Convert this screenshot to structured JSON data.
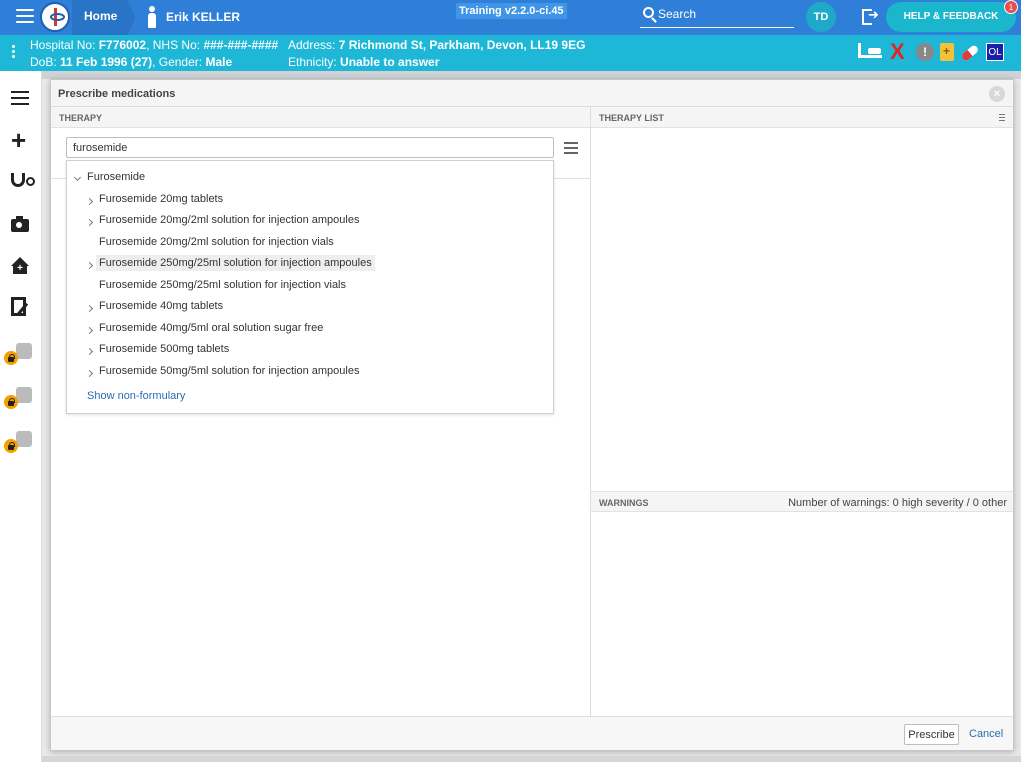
{
  "topbar": {
    "home_label": "Home",
    "patient_name": "Erik KELLER",
    "environment": "Training v2.2.0-ci.45",
    "search_label": "Search",
    "user_initials": "TD",
    "help_label": "HELP & FEEDBACK",
    "help_badge": "1",
    "accent": "#2f7fd8"
  },
  "banner": {
    "hospital_label": "Hospital No: ",
    "hospital_no": "F776002",
    "nhs_label": ", NHS No: ",
    "nhs_no": "###-###-####",
    "dob_label": "DoB: ",
    "dob": "11 Feb 1996 (27)",
    "gender_label": ", Gender: ",
    "gender": "Male",
    "address_label": "Address: ",
    "address": "7 Richmond St, Parkham, Devon, LL19 9EG",
    "ethnicity_label": "Ethnicity: ",
    "ethnicity": "Unable to answer",
    "ol_badge": "OL",
    "alert_symbol": "!",
    "x_symbol": "X",
    "color": "#1fb7d8"
  },
  "leftnav": {
    "items": [
      {
        "icon": "list-icon"
      },
      {
        "icon": "plus-icon"
      },
      {
        "icon": "stethoscope-icon"
      },
      {
        "icon": "camera-icon"
      },
      {
        "icon": "home-plus-icon"
      },
      {
        "icon": "document-sign-icon"
      },
      {
        "icon": "clipboard-icon",
        "locked": true
      },
      {
        "icon": "walking-icon",
        "locked": true
      },
      {
        "icon": "plus-icon",
        "locked": true
      }
    ]
  },
  "modal": {
    "title": "Prescribe medications",
    "therapy": {
      "header": "THERAPY",
      "search_value": "furosemide",
      "results": [
        {
          "label": "Furosemide",
          "level": 0,
          "expander": "down"
        },
        {
          "label": "Furosemide 20mg tablets",
          "level": 1,
          "expander": "right"
        },
        {
          "label": "Furosemide 20mg/2ml solution for injection ampoules",
          "level": 1,
          "expander": "right"
        },
        {
          "label": "Furosemide 20mg/2ml solution for injection vials",
          "level": 1,
          "expander": "none"
        },
        {
          "label": "Furosemide 250mg/25ml solution for injection ampoules",
          "level": 1,
          "expander": "right",
          "highlighted": true
        },
        {
          "label": "Furosemide 250mg/25ml solution for injection vials",
          "level": 1,
          "expander": "none"
        },
        {
          "label": "Furosemide 40mg tablets",
          "level": 1,
          "expander": "right"
        },
        {
          "label": "Furosemide 40mg/5ml oral solution sugar free",
          "level": 1,
          "expander": "right"
        },
        {
          "label": "Furosemide 500mg tablets",
          "level": 1,
          "expander": "right"
        },
        {
          "label": "Furosemide 50mg/5ml solution for injection ampoules",
          "level": 1,
          "expander": "right"
        }
      ],
      "show_non_formulary": "Show non-formulary"
    },
    "therapy_list": {
      "header": "THERAPY LIST"
    },
    "warnings": {
      "header": "WARNINGS",
      "count_text": "Number of warnings: 0 high severity / 0 other"
    },
    "footer": {
      "prescribe_label": "Prescribe",
      "cancel_label": "Cancel"
    }
  }
}
